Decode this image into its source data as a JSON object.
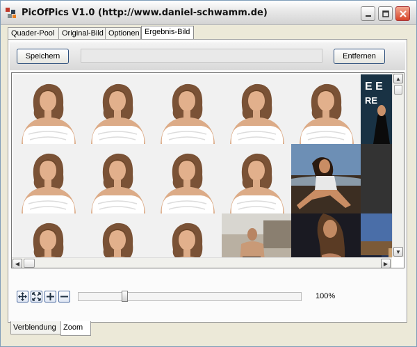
{
  "window": {
    "title": "PicOfPics V1.0 (http://www.daniel-schwamm.de)",
    "accent": "#2d4f7c",
    "close_color": "#d8452a"
  },
  "tabs": [
    {
      "label": "Quader-Pool",
      "active": false
    },
    {
      "label": "Original-Bild",
      "active": false
    },
    {
      "label": "Optionen",
      "active": false
    },
    {
      "label": "Ergebnis-Bild",
      "active": true
    }
  ],
  "toolbar": {
    "save_label": "Speichern",
    "remove_label": "Entfernen",
    "path_value": ""
  },
  "mosaic": {
    "tiles": [
      [
        "portrait",
        "portrait",
        "portrait",
        "portrait",
        "portrait",
        "magazine"
      ],
      [
        "portrait",
        "portrait",
        "portrait",
        "portrait",
        "beach",
        "dark"
      ],
      [
        "portrait",
        "portrait",
        "portrait",
        "group",
        "hair",
        "stadium"
      ]
    ]
  },
  "zoom": {
    "value_label": "100%",
    "slider_fraction": 0.2,
    "buttons": [
      "move-icon",
      "fit-icon",
      "zoom-in-icon",
      "zoom-out-icon"
    ]
  },
  "bottom_tabs": [
    {
      "label": "Verblendung",
      "active": false
    },
    {
      "label": "Zoom",
      "active": true
    }
  ]
}
